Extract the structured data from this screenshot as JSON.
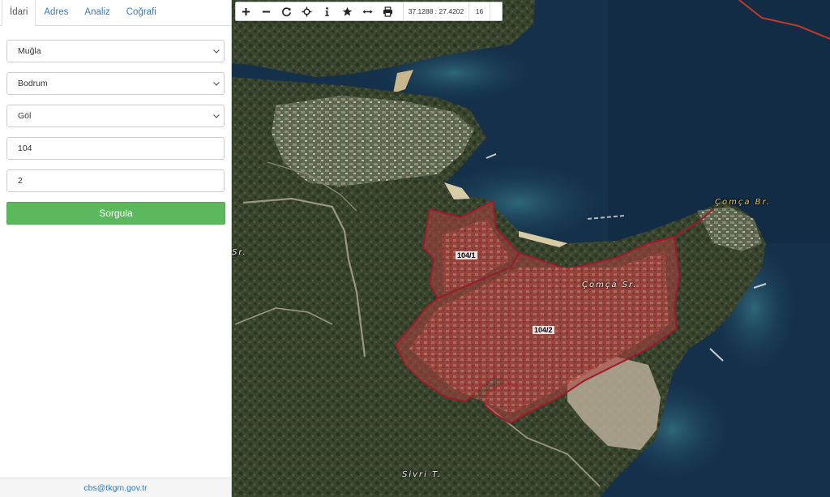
{
  "sidebar": {
    "tabs": [
      {
        "label": "İdari",
        "active": true
      },
      {
        "label": "Adres"
      },
      {
        "label": "Analiz"
      },
      {
        "label": "Coğrafi"
      }
    ],
    "form": {
      "province": "Muğla",
      "district": "Bodrum",
      "neighborhood": "Göl",
      "block": "104",
      "parcel": "2"
    },
    "query_button": "Sorgula",
    "footer_email": "cbs@tkgm.gov.tr"
  },
  "toolbar": {
    "icons": [
      "zoom-in-icon",
      "zoom-out-icon",
      "refresh-icon",
      "locate-icon",
      "info-icon",
      "star-icon",
      "measure-icon",
      "print-icon"
    ],
    "coordinates": "37.1288 : 27.4202",
    "zoom_level": "16"
  },
  "map": {
    "labels": {
      "bay_name": "Çomça Br.",
      "area_name": "Çomça Sr.",
      "hill_name": "Sivri T.",
      "partial_label": "Sr."
    },
    "parcels": [
      {
        "label": "104/1"
      },
      {
        "label": "104/2"
      }
    ],
    "colors": {
      "parcel_outline": "#9b1b2b",
      "parcel_fill": "#b0423f",
      "boundary_line": "#c0392b",
      "sea": "#14304a",
      "query_button": "#5cb85c"
    }
  }
}
